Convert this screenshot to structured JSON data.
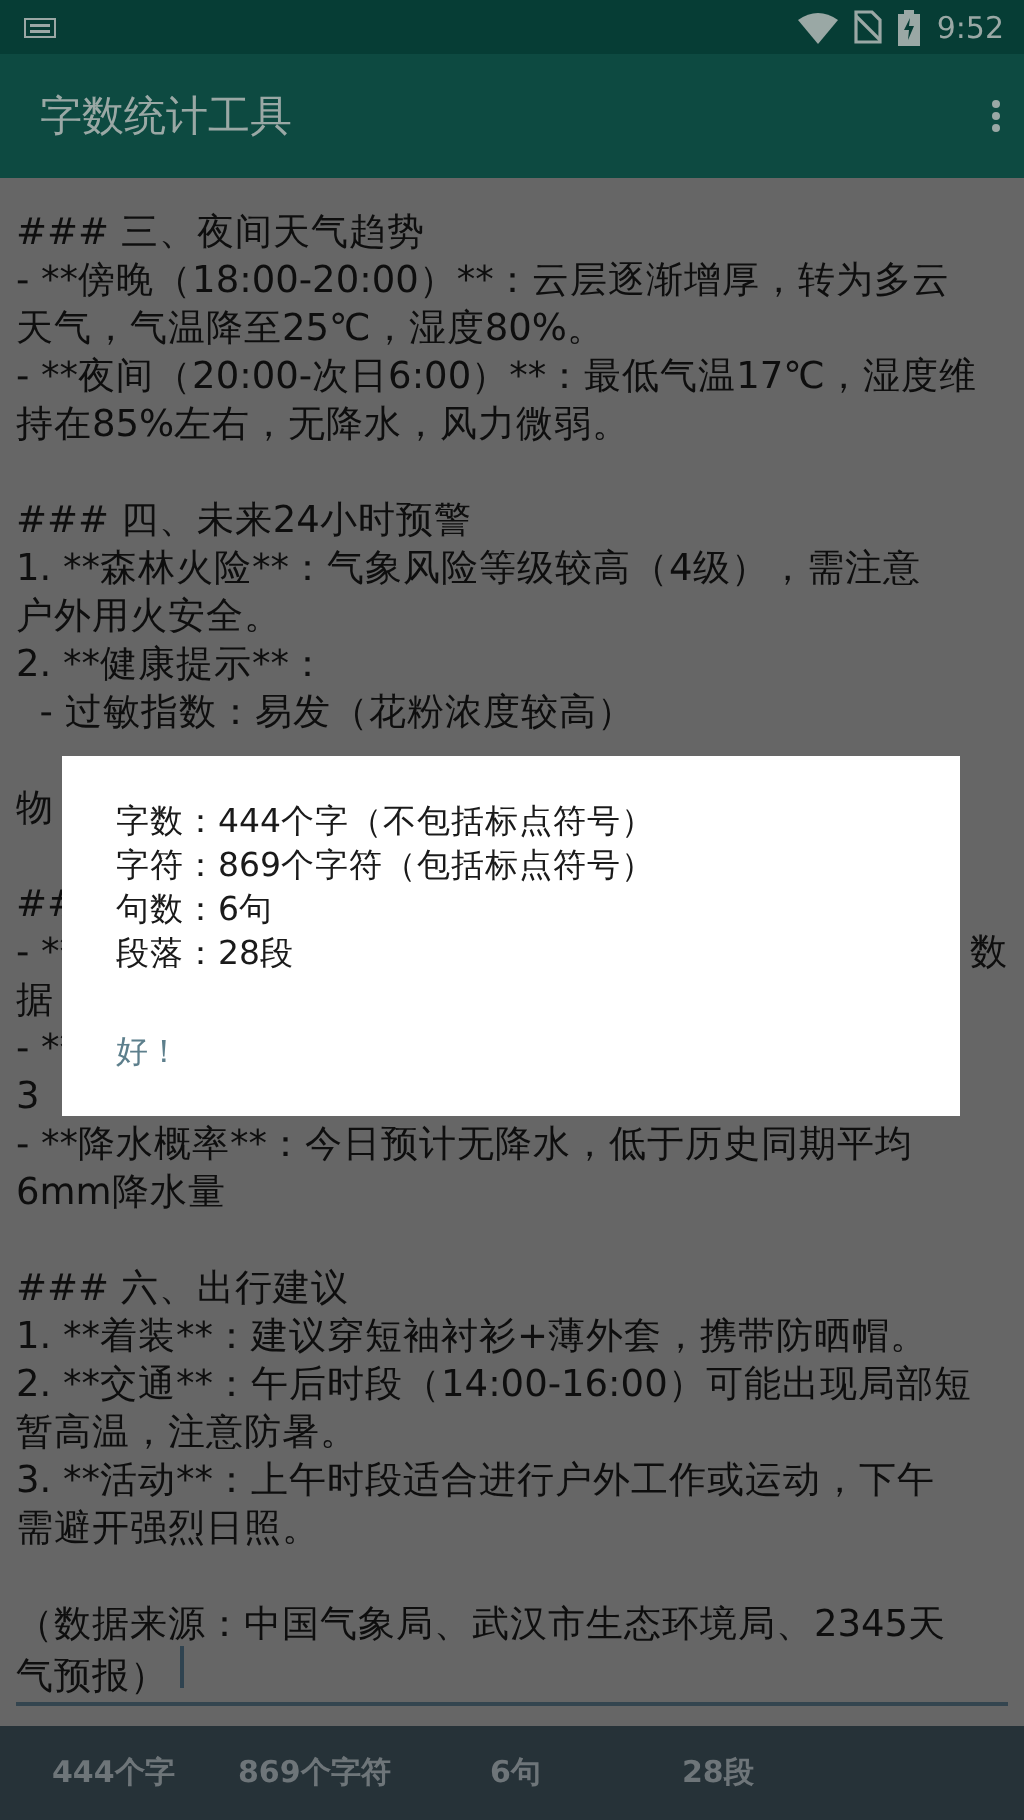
{
  "status_bar": {
    "time": "9:52"
  },
  "app_bar": {
    "title": "字数统计工具"
  },
  "editor": {
    "lines": [
      {
        "text": "### 三、夜间天气趋势"
      },
      {
        "text": "- **傍晚（18:00-20:00）**：云层逐渐增厚，转为多云"
      },
      {
        "text": "天气，气温降至25℃，湿度80%。"
      },
      {
        "text": "- **夜间（20:00-次日6:00）**：最低气温17℃，湿度维"
      },
      {
        "text": "持在85%左右，无降水，风力微弱。"
      },
      {
        "text": "### 四、未来24小时预警",
        "blank_before": true
      },
      {
        "text": "1. **森林火险**：气象风险等级较高（4级），需注意"
      },
      {
        "text": "户外用火安全。"
      },
      {
        "text": "2. **健康提示**："
      },
      {
        "text": "  - 过敏指数：易发（花粉浓度较高）"
      },
      {
        "text": "物",
        "blank_before": true
      },
      {
        "text": "##",
        "blank_before": true
      },
      {
        "text": "- **",
        "end": "数"
      },
      {
        "text": "据"
      },
      {
        "text": "- **"
      },
      {
        "text": "3"
      },
      {
        "text": "- **降水概率**：今日预计无降水，低于历史同期平均"
      },
      {
        "text": "6mm降水量"
      },
      {
        "text": "### 六、出行建议",
        "blank_before": true
      },
      {
        "text": "1. **着装**：建议穿短袖衬衫+薄外套，携带防晒帽。"
      },
      {
        "text": "2. **交通**：午后时段（14:00-16:00）可能出现局部短"
      },
      {
        "text": "暂高温，注意防暑。"
      },
      {
        "text": "3. **活动**：上午时段适合进行户外工作或运动，下午"
      },
      {
        "text": "需避开强烈日照。"
      },
      {
        "text": "（数据来源：中国气象局、武汉市生态环境局、2345天",
        "blank_before": true
      },
      {
        "text": "气预报）",
        "cursor": true
      }
    ]
  },
  "stats_bar": [
    "444个字",
    "869个字符",
    "6句",
    "28段"
  ],
  "dialog": {
    "lines": [
      "字数：444个字（不包括标点符号）",
      "字符：869个字符（包括标点符号）",
      "句数：6句",
      "段落：28段"
    ],
    "button": "好！"
  }
}
